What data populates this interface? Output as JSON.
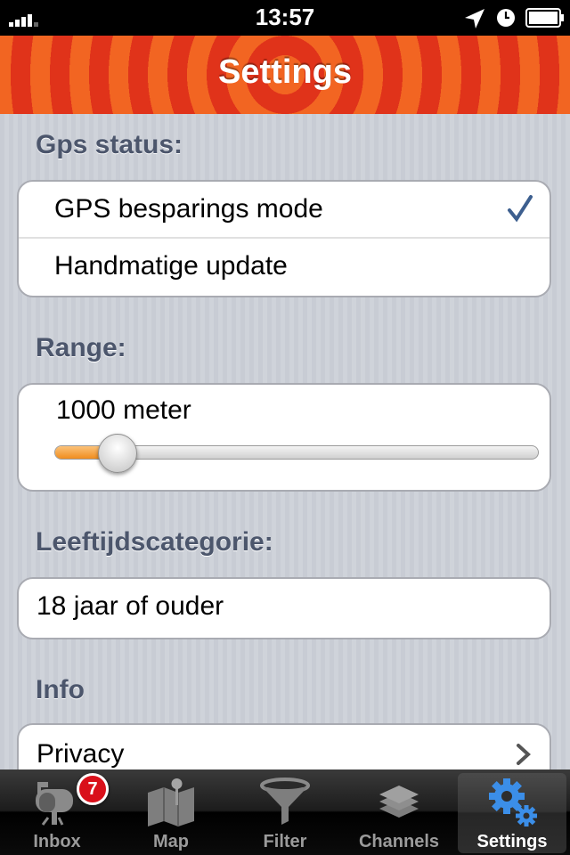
{
  "status_bar": {
    "time": "13:57"
  },
  "header": {
    "title": "Settings"
  },
  "gps": {
    "section_title": "Gps status:",
    "options": [
      {
        "label": "GPS besparings mode",
        "selected": true
      },
      {
        "label": "Handmatige update",
        "selected": false
      }
    ]
  },
  "range": {
    "section_title": "Range:",
    "value_label": "1000 meter",
    "slider_fraction": 0.13
  },
  "age": {
    "section_title": "Leeftijdscategorie:",
    "value": "18 jaar of ouder"
  },
  "info": {
    "section_title": "Info",
    "items": [
      {
        "label": "Privacy"
      }
    ]
  },
  "tabbar": {
    "tabs": [
      {
        "label": "Inbox",
        "badge": "7"
      },
      {
        "label": "Map"
      },
      {
        "label": "Filter"
      },
      {
        "label": "Channels"
      },
      {
        "label": "Settings",
        "active": true
      }
    ]
  },
  "colors": {
    "accent": "#f26522",
    "check": "#3d5f8f",
    "badge": "#d9101a"
  }
}
